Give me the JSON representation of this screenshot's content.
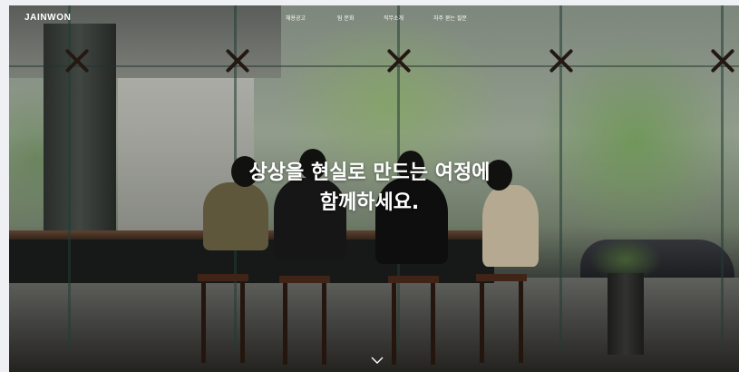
{
  "header": {
    "logo": "JAINWON",
    "nav": [
      {
        "label": "채용공고"
      },
      {
        "label": "팀 문화"
      },
      {
        "label": "직무소개"
      },
      {
        "label": "자주 묻는 질문"
      }
    ]
  },
  "hero": {
    "line1": "상상을 현실로 만드는 여정에",
    "line2": "함께하세요.",
    "scroll_icon": "chevron-down-icon"
  },
  "colors": {
    "text": "#ffffff",
    "page_background": "#eef0f3"
  }
}
